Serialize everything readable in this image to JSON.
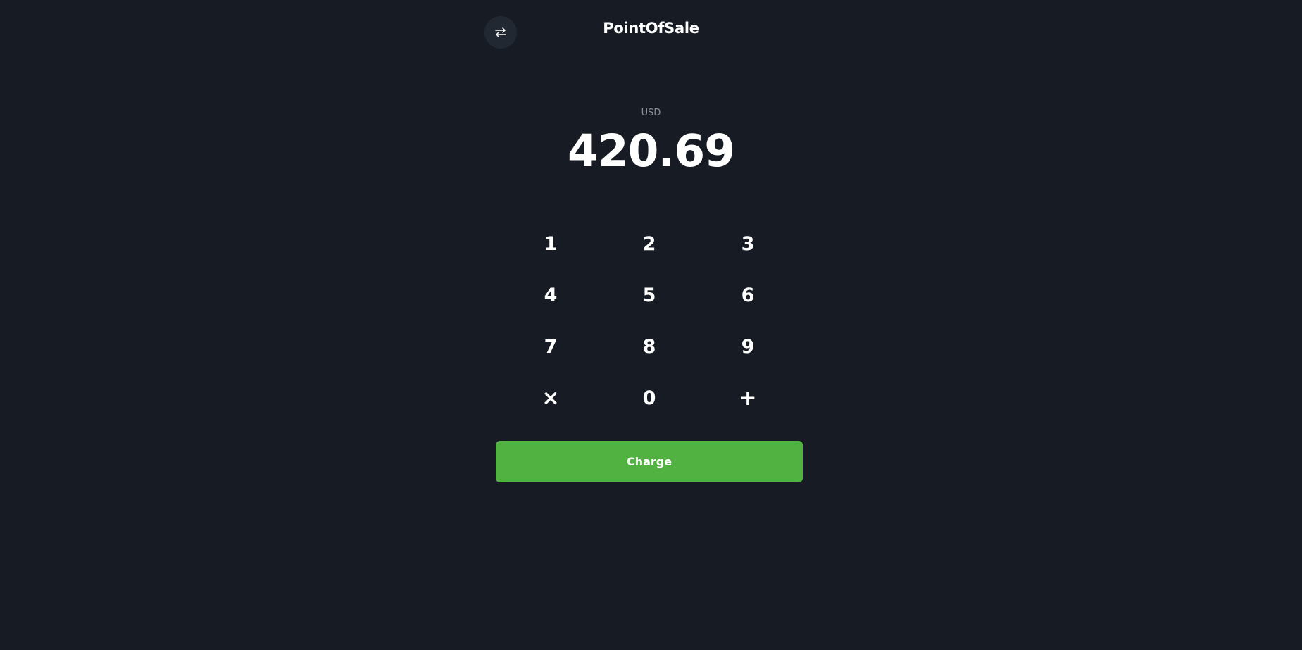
{
  "header": {
    "title": "PointOfSale",
    "switch_icon": "swap-arrows-icon"
  },
  "display": {
    "currency": "USD",
    "amount": "420.69"
  },
  "keypad": {
    "keys": [
      "1",
      "2",
      "3",
      "4",
      "5",
      "6",
      "7",
      "8",
      "9",
      "×",
      "0",
      "+"
    ]
  },
  "actions": {
    "charge_label": "Charge"
  },
  "colors": {
    "background": "#171c24",
    "charge_button": "#51b141",
    "switch_button_bg": "#222832",
    "muted_text": "#8a9099"
  }
}
